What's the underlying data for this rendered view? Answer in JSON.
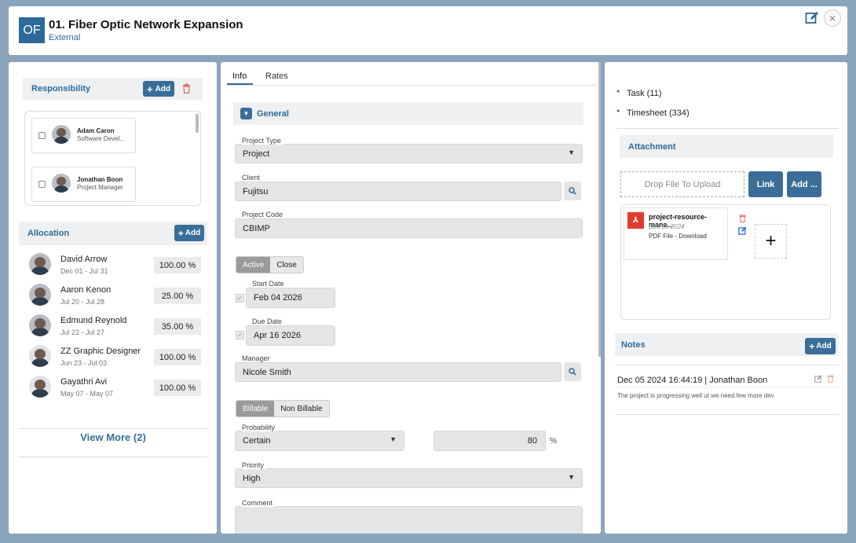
{
  "header": {
    "avatar": "OF",
    "title": "01. Fiber Optic Network Expansion",
    "subtitle": "External",
    "close_icon": "×"
  },
  "responsibility": {
    "title": "Responsibility",
    "add_label": "Add",
    "members": [
      {
        "name": "Adam Caron",
        "role": "Software Devel..."
      },
      {
        "name": "Jonathan Boon",
        "role": "Project Manager"
      }
    ]
  },
  "allocation": {
    "title": "Allocation",
    "add_label": "Add",
    "rows": [
      {
        "name": "David Arrow",
        "dates": "Dec 01 - Jul 31",
        "percent": "100.00 %"
      },
      {
        "name": "Aaron Kenon",
        "dates": "Jul 20 - Jul 28",
        "percent": "25.00 %"
      },
      {
        "name": "Edmund Reynold",
        "dates": "Jul 22 - Jul 27",
        "percent": "35.00 %"
      },
      {
        "name": "ZZ Graphic Designer",
        "dates": "Jun 23 - Jul 03",
        "percent": "100.00 %"
      },
      {
        "name": "Gayathri Avi",
        "dates": "May 07 - May 07",
        "percent": "100.00 %"
      }
    ],
    "view_more": "View More (2)"
  },
  "tabs": [
    "Info",
    "Rates"
  ],
  "general": {
    "title": "General",
    "project_type": {
      "label": "Project Type",
      "value": "Project"
    },
    "client": {
      "label": "Client",
      "value": "Fujitsu"
    },
    "project_code": {
      "label": "Project Code",
      "value": "CBIMP"
    },
    "status": {
      "active": "Active",
      "close": "Close"
    },
    "start_date": {
      "label": "Start Date",
      "value": "Feb 04 2026"
    },
    "due_date": {
      "label": "Due Date",
      "value": "Apr 16 2026"
    },
    "manager": {
      "label": "Manager",
      "value": "Nicole Smith"
    },
    "billing": {
      "billable": "Billable",
      "non_billable": "Non Billable"
    },
    "probability": {
      "label": "Probability",
      "value": "Certain",
      "percent_value": "80",
      "unit": "%"
    },
    "priority": {
      "label": "Priority",
      "value": "High"
    },
    "comment": {
      "label": "Comment"
    }
  },
  "summary": [
    {
      "label": "Task (11)"
    },
    {
      "label": "Timesheet (334)"
    }
  ],
  "attachment": {
    "title": "Attachment",
    "drop_label": "Drop File To Upload",
    "link_label": "Link",
    "add_label": "Add ...",
    "file": {
      "name": "project-resource-mana...",
      "date": "Dec 05 2024",
      "type": "PDF File - Download"
    }
  },
  "notes": {
    "title": "Notes",
    "add_label": "Add",
    "entry": {
      "header": "Dec 05 2024 16:44:19 | Jonathan Boon",
      "body": "The project is progressing well ut we need few more dev"
    }
  },
  "colors": {
    "accent": "#2d6a9b",
    "button": "#3a6e98",
    "danger": "#e0695a"
  }
}
